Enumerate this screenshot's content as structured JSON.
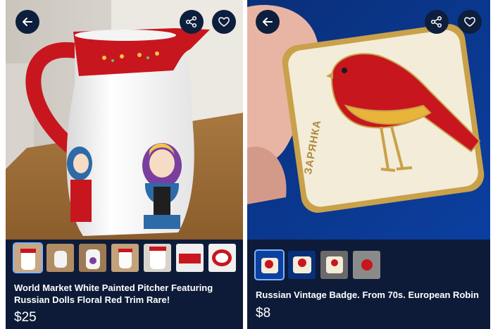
{
  "colors": {
    "panel_bg": "#0d1b38",
    "button_bg": "#0e1f3d",
    "icon": "#ffffff"
  },
  "listings": [
    {
      "title": "World Market White Painted Pitcher Featuring Russian Dolls Floral Red Trim Rare!",
      "price": "$25",
      "thumbnail_count": 7,
      "icons": [
        "back-arrow-icon",
        "share-icon",
        "heart-icon"
      ]
    },
    {
      "title": "Russian Vintage Badge. From 70s. European Robin",
      "price": "$8",
      "badge_text": "ЗАРЯНКА",
      "thumbnail_count": 4,
      "icons": [
        "back-arrow-icon",
        "share-icon",
        "heart-icon"
      ]
    }
  ]
}
